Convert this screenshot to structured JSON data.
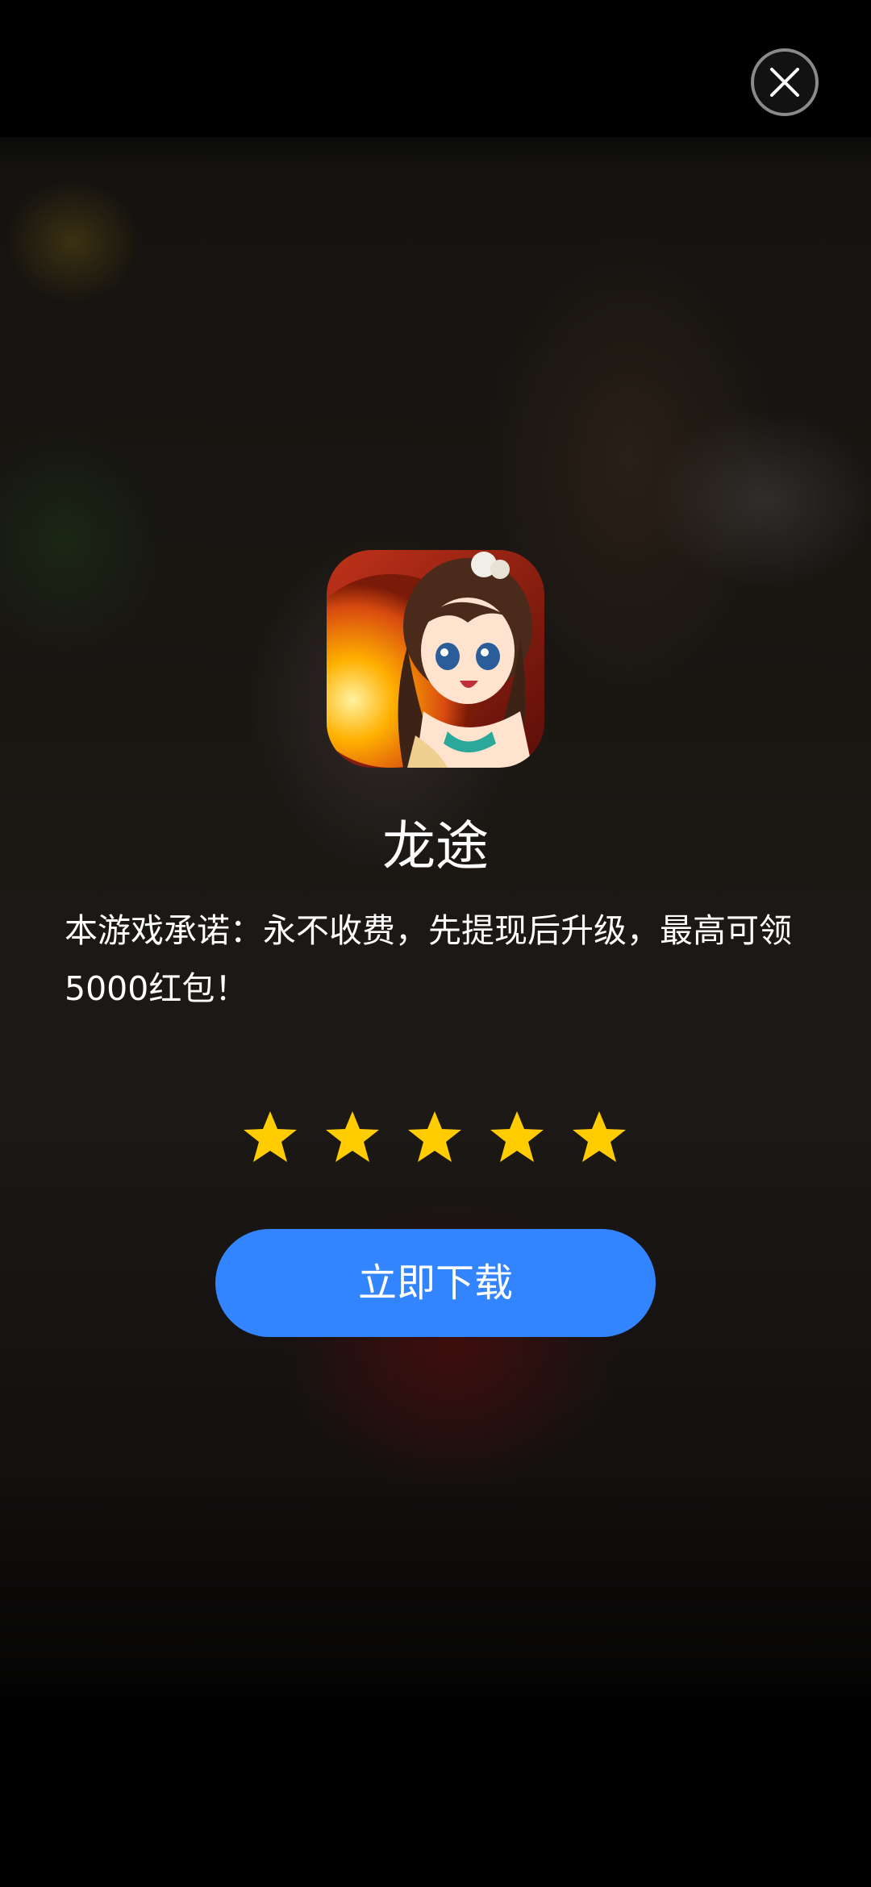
{
  "app": {
    "name": "龙途",
    "description": "本游戏承诺：永不收费，先提现后升级，最高可领5000红包！",
    "rating": 5,
    "rating_max": 5
  },
  "actions": {
    "download_label": "立即下载"
  },
  "icons": {
    "close": "close-icon",
    "star": "star-icon",
    "app": "app-icon"
  },
  "colors": {
    "accent": "#3385ff",
    "star": "#ffcc00",
    "text": "#ffffff"
  }
}
